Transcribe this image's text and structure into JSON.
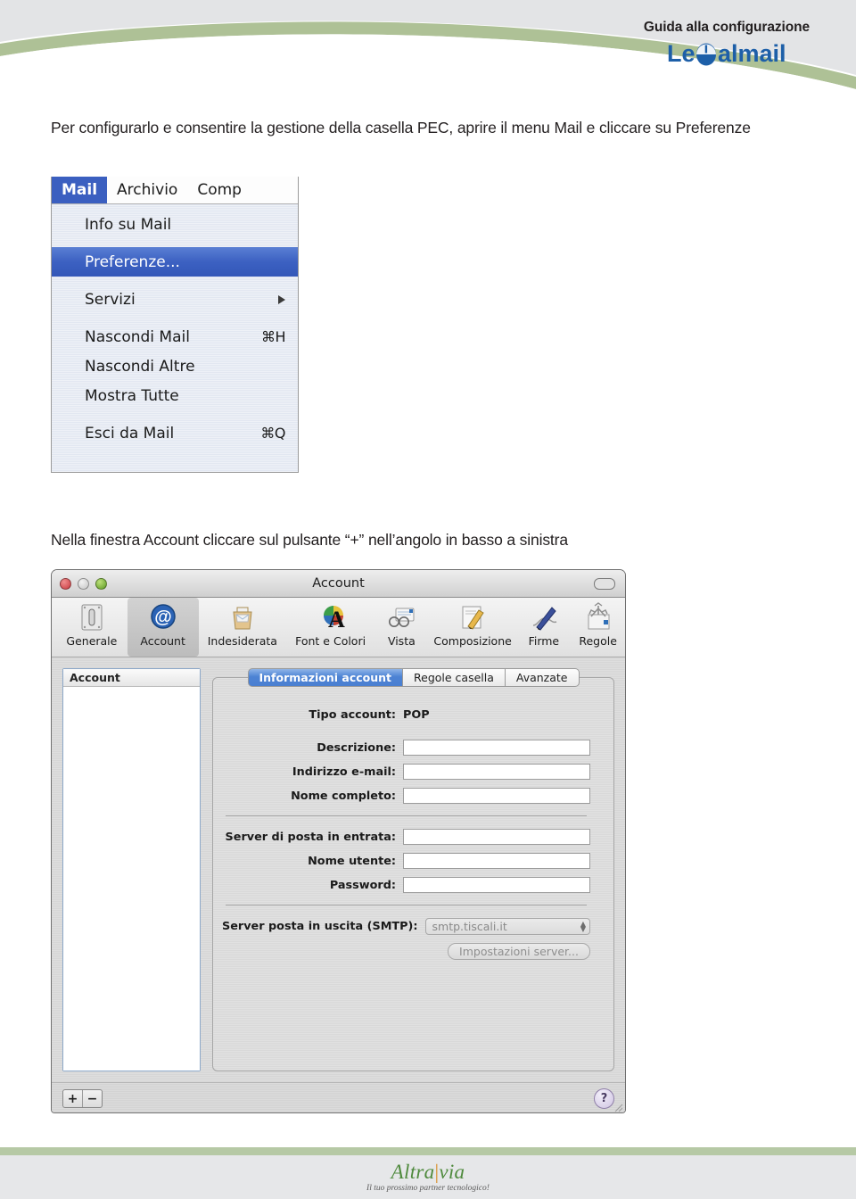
{
  "header": {
    "title": "Guida alla configurazione",
    "brand": "Legalmail",
    "brand_part1": "Le",
    "brand_part2": "almail",
    "colors": {
      "brand_blue": "#1d5fa8",
      "swoosh_green": "#aec196",
      "header_gray": "#e3e4e6"
    }
  },
  "content": {
    "paragraph_1": "Per configurarlo e consentire la gestione della casella PEC, aprire il menu Mail e cliccare su Preferenze",
    "paragraph_2": "Nella finestra Account cliccare sul pulsante “+” nell’angolo in basso a sinistra"
  },
  "mail_menu": {
    "menubar": [
      {
        "label": "Mail",
        "active": true
      },
      {
        "label": "Archivio",
        "active": false
      },
      {
        "label": "Comp",
        "active": false
      }
    ],
    "items": [
      {
        "label": "Info su Mail",
        "shortcut": "",
        "selected": false,
        "submenu": false
      },
      {
        "label": "Preferenze...",
        "shortcut": "",
        "selected": true,
        "submenu": false
      },
      {
        "label": "Servizi",
        "shortcut": "",
        "selected": false,
        "submenu": true
      },
      {
        "label": "Nascondi Mail",
        "shortcut": "⌘H",
        "selected": false,
        "submenu": false
      },
      {
        "label": "Nascondi Altre",
        "shortcut": "",
        "selected": false,
        "submenu": false
      },
      {
        "label": "Mostra Tutte",
        "shortcut": "",
        "selected": false,
        "submenu": false
      },
      {
        "label": "Esci da Mail",
        "shortcut": "⌘Q",
        "selected": false,
        "submenu": false
      }
    ]
  },
  "account_window": {
    "title": "Account",
    "toolbar": [
      {
        "label": "Generale",
        "icon": "general-icon",
        "selected": false
      },
      {
        "label": "Account",
        "icon": "at-sign-icon",
        "selected": true
      },
      {
        "label": "Indesiderata",
        "icon": "junk-mail-icon",
        "selected": false
      },
      {
        "label": "Font e Colori",
        "icon": "font-colors-icon",
        "selected": false
      },
      {
        "label": "Vista",
        "icon": "view-glasses-icon",
        "selected": false
      },
      {
        "label": "Composizione",
        "icon": "compose-pencil-icon",
        "selected": false
      },
      {
        "label": "Firme",
        "icon": "signature-pen-icon",
        "selected": false
      },
      {
        "label": "Regole",
        "icon": "rules-icon",
        "selected": false
      }
    ],
    "sidebar": {
      "header": "Account",
      "items": []
    },
    "tabs": [
      {
        "label": "Informazioni account",
        "active": true
      },
      {
        "label": "Regole casella",
        "active": false
      },
      {
        "label": "Avanzate",
        "active": false
      }
    ],
    "form": {
      "account_type_label": "Tipo account:",
      "account_type_value": "POP",
      "fields_group_1": [
        {
          "label": "Descrizione:",
          "value": ""
        },
        {
          "label": "Indirizzo e-mail:",
          "value": ""
        },
        {
          "label": "Nome completo:",
          "value": ""
        }
      ],
      "fields_group_2": [
        {
          "label": "Server di posta in entrata:",
          "value": ""
        },
        {
          "label": "Nome utente:",
          "value": ""
        },
        {
          "label": "Password:",
          "value": ""
        }
      ],
      "smtp_label": "Server posta in uscita (SMTP):",
      "smtp_value": "smtp.tiscali.it",
      "server_settings_button": "Impostazioni server..."
    },
    "footer": {
      "add_button": "+",
      "remove_button": "−",
      "help_button": "?"
    }
  },
  "page_footer": {
    "logo_part1": "Altra",
    "logo_divider": "|",
    "logo_part2": "via",
    "tagline": "Il tuo prossimo partner tecnologico!"
  }
}
